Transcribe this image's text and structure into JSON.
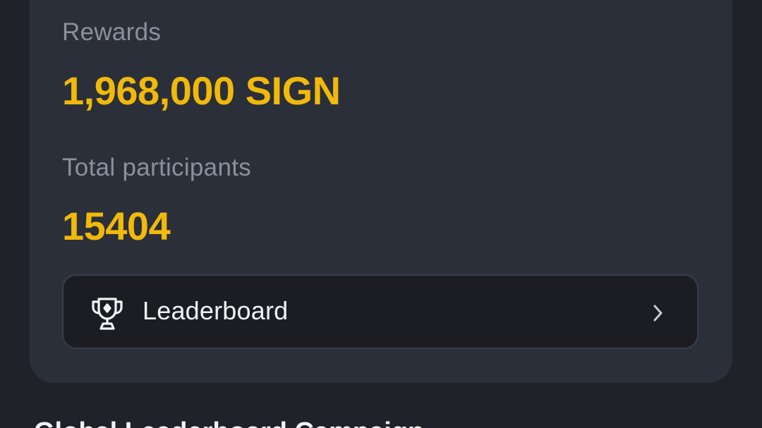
{
  "stats": {
    "rewards_label": "Rewards",
    "rewards_value": "1,968,000 SIGN",
    "participants_label": "Total participants",
    "participants_value": "15404"
  },
  "leaderboard": {
    "label": "Leaderboard",
    "icon": "trophy-icon",
    "chevron": "chevron-right-icon"
  },
  "next_section": {
    "heading": "Global Leaderboard Campaign"
  },
  "colors": {
    "background": "#1f2228",
    "card": "#2b2f39",
    "accent": "#f0b90b",
    "muted_text": "#8a919e",
    "button_bg": "#1c1d22"
  }
}
